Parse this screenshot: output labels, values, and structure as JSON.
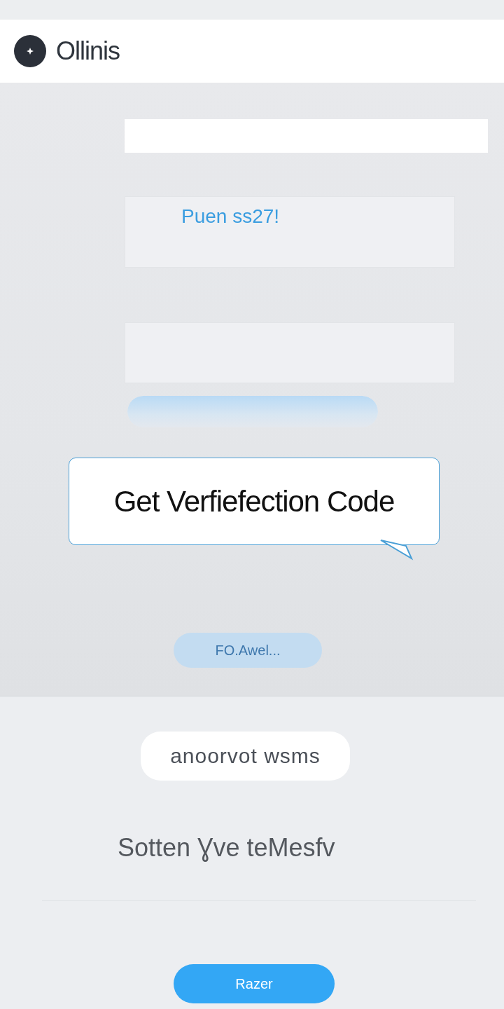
{
  "header": {
    "brand": "Ollinis"
  },
  "form": {
    "fields": [
      {
        "kind": "solid"
      },
      {
        "kind": "inset",
        "value": "Puen ss27!"
      },
      {
        "kind": "inset"
      }
    ],
    "tooltip": {
      "text": "Get Verfiefection Code"
    },
    "forward_button": {
      "label": "FO.Awel...",
      "disabled": true
    }
  },
  "lower": {
    "chip": "anoorvot wsms",
    "message": "Sotten Ɣve teMesfv",
    "primary_button": "Razer"
  }
}
